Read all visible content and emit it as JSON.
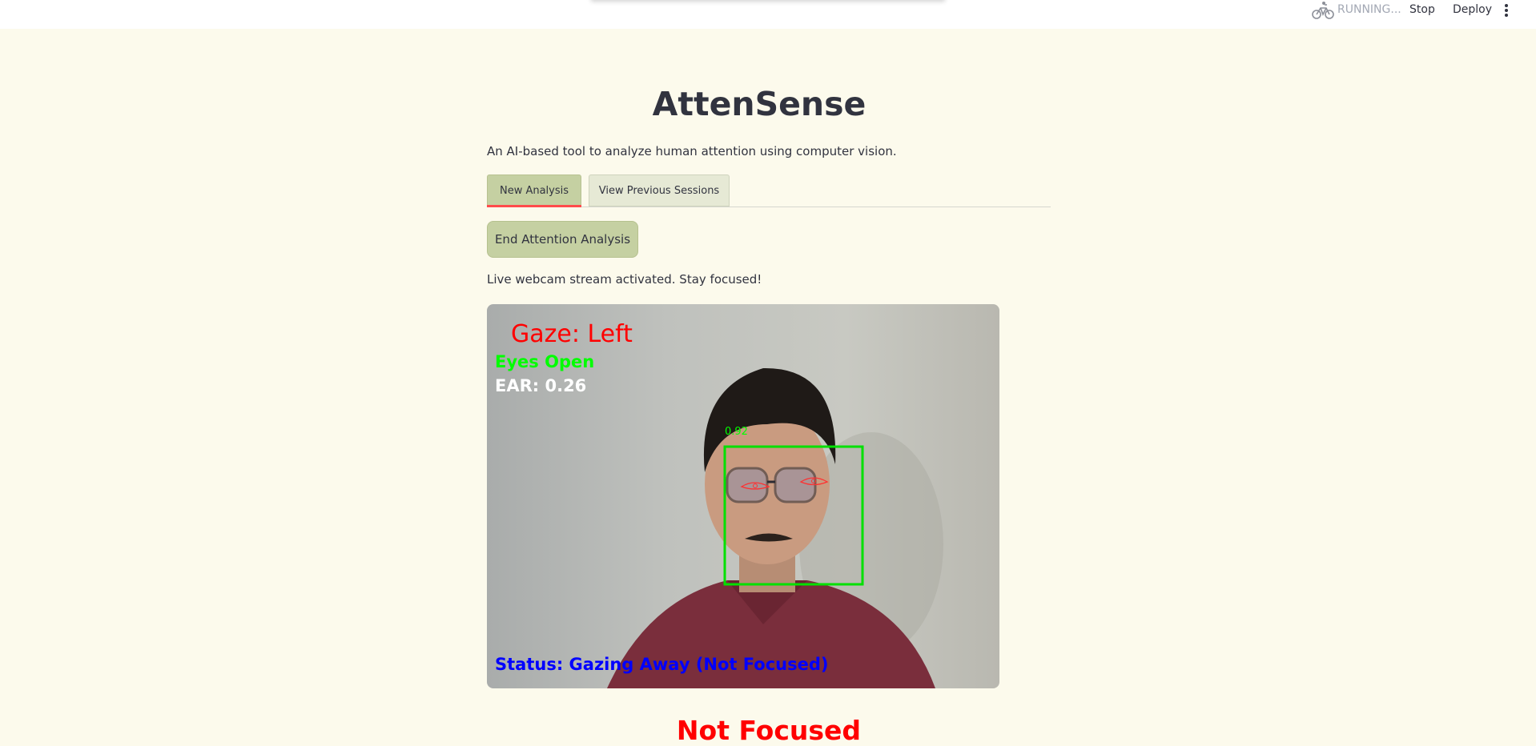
{
  "topbar": {
    "status": "RUNNING...",
    "stop_label": "Stop",
    "deploy_label": "Deploy",
    "status_icon": "bike-icon",
    "menu_icon": "kebab-menu-icon"
  },
  "app": {
    "title": "AttenSense",
    "subtitle": "An AI-based tool to analyze human attention using computer vision."
  },
  "tabs": [
    {
      "label": "New Analysis",
      "active": true
    },
    {
      "label": "View Previous Sessions",
      "active": false
    }
  ],
  "actions": {
    "end_button": "End Attention Analysis"
  },
  "stream": {
    "info": "Live webcam stream activated. Stay focused!",
    "overlay": {
      "gaze": "Gaze: Left",
      "eyes": "Eyes Open",
      "ear": "EAR: 0.26",
      "confidence": "0.92",
      "status": "Status: Gazing Away (Not Focused)"
    }
  },
  "result": {
    "label": "Not Focused"
  },
  "colors": {
    "background": "#fcfaec",
    "accent": "#c5d0a2",
    "tab_underline": "#ff4b4b",
    "alert": "#ff0000",
    "overlay_green": "#00ff00",
    "overlay_blue": "#0000ff"
  }
}
